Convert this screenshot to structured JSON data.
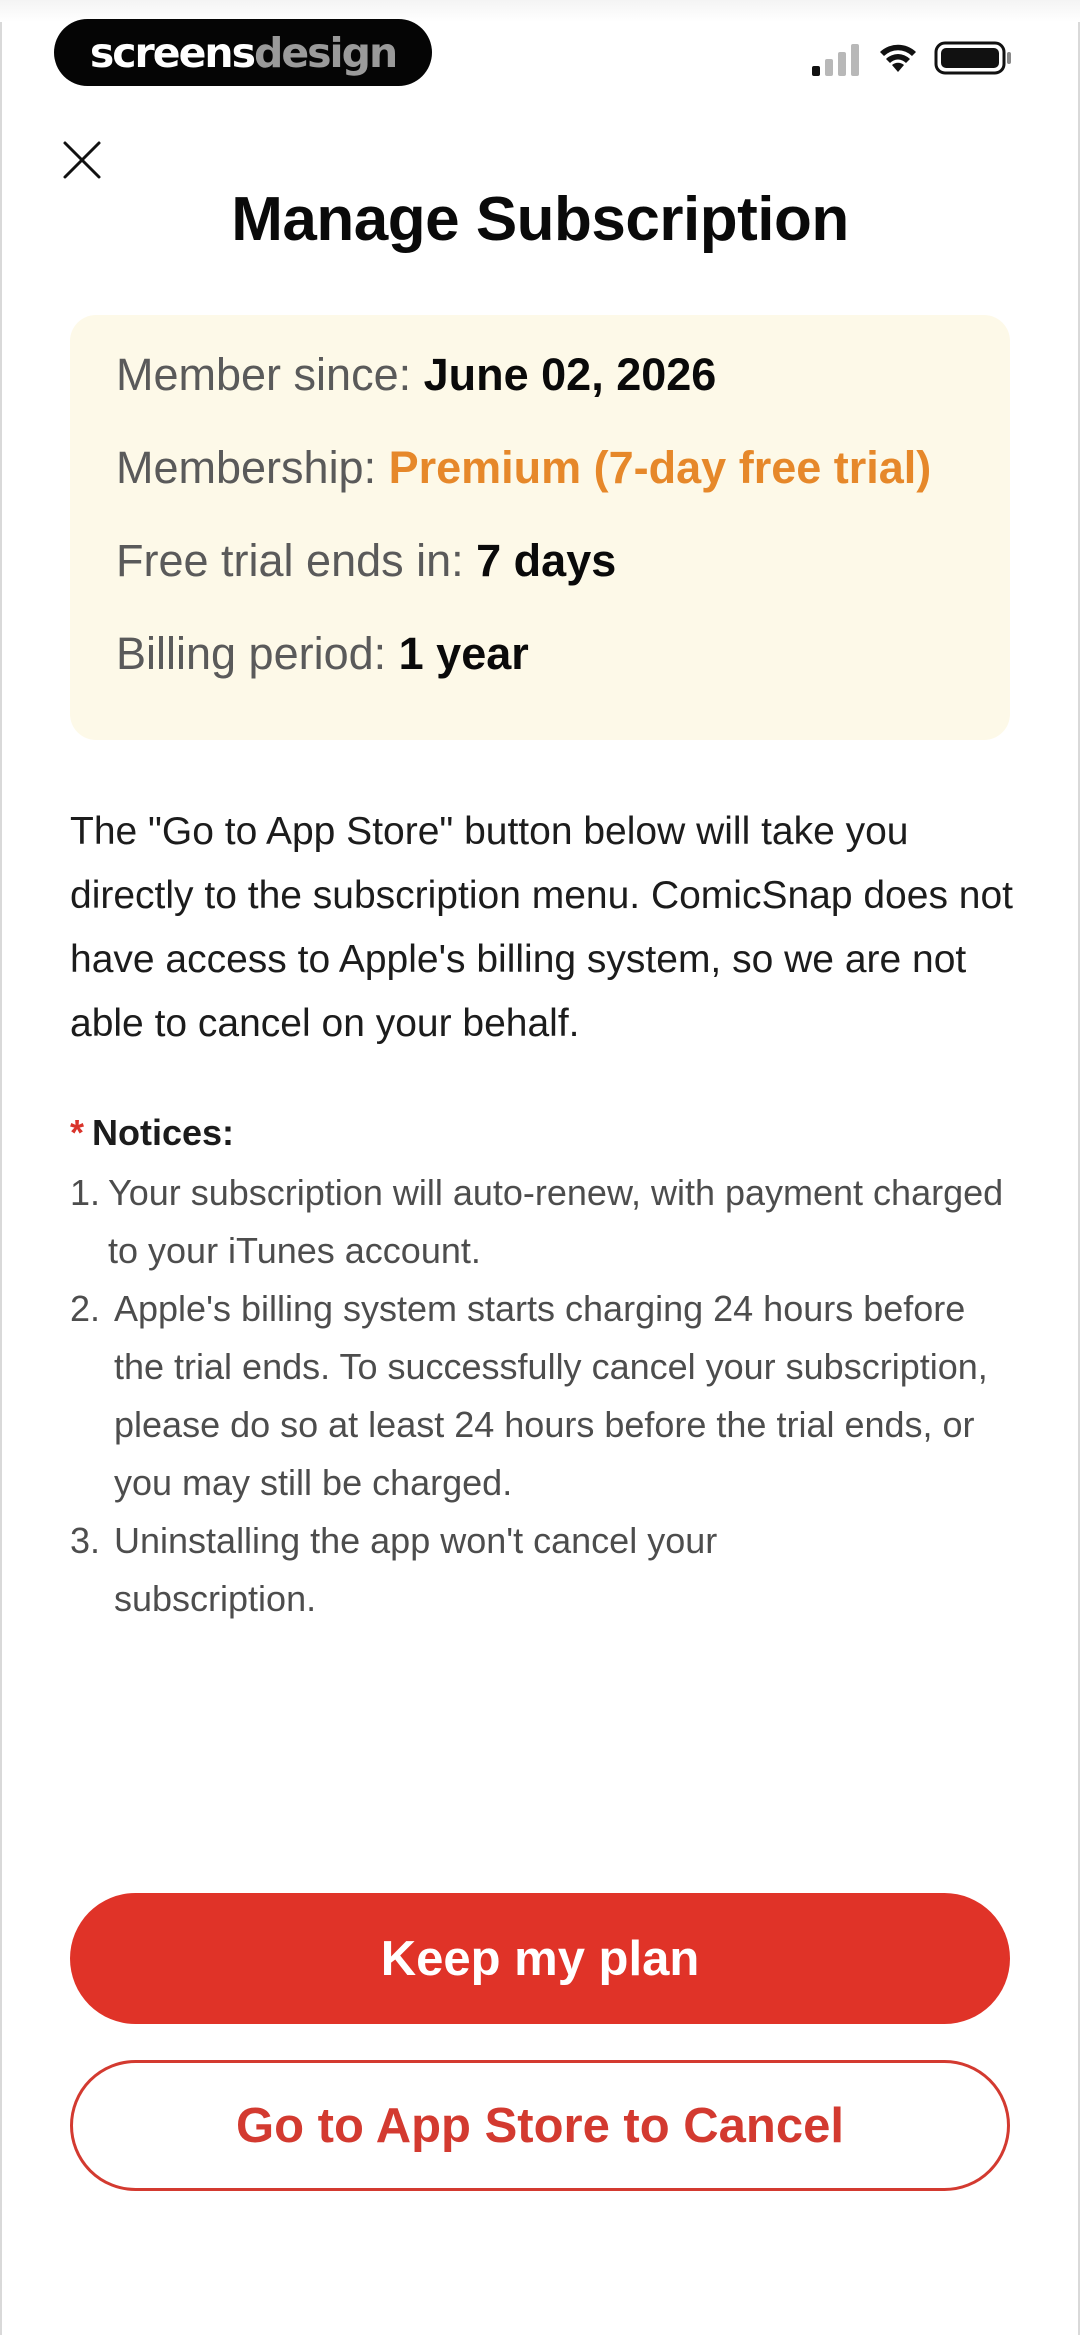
{
  "status_bar": {
    "brand_part1": "screens",
    "brand_part2": "design"
  },
  "header": {
    "title": "Manage Subscription"
  },
  "subscription": {
    "member_since_label": "Member since: ",
    "member_since_value": "June 02, 2026",
    "membership_label": "Membership: ",
    "membership_value": "Premium (7-day free trial)",
    "trial_label": "Free trial ends in: ",
    "trial_value": "7 days",
    "billing_label": "Billing period: ",
    "billing_value": "1 year"
  },
  "description": "The \"Go to App Store\" button below will take you directly to the subscription menu. ComicSnap does not have access to Apple's billing system, so we are not able to cancel on your behalf.",
  "notices": {
    "marker": "*",
    "heading": "Notices:",
    "items": [
      {
        "num": "1.",
        "text": "Your subscription will auto-renew, with payment charged to your iTunes account."
      },
      {
        "num": "2.",
        "text": "Apple's billing system starts charging 24 hours before the trial ends. To successfully cancel your subscription, please do so at least 24 hours before the trial ends, or you may still be charged."
      },
      {
        "num": "3.",
        "text": "Uninstalling the app won't cancel your subscription."
      }
    ]
  },
  "actions": {
    "keep_label": "Keep my plan",
    "cancel_label": "Go to App Store to Cancel"
  },
  "colors": {
    "primary": "#e03328",
    "accent": "#e6882a",
    "card_bg": "#fdf9e8"
  }
}
